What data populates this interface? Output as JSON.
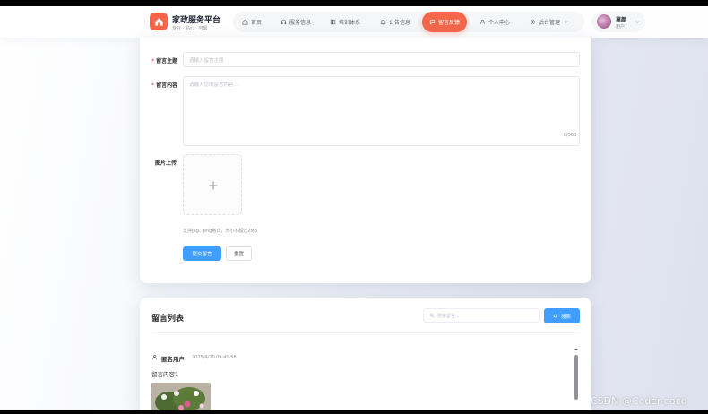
{
  "header": {
    "site_title": "家政服务平台",
    "site_subtitle": "专业 · 贴心 · 可靠",
    "nav": [
      {
        "label": "首页",
        "icon": "home-icon"
      },
      {
        "label": "服务信息",
        "icon": "headset-icon"
      },
      {
        "label": "培训体系",
        "icon": "book-icon"
      },
      {
        "label": "公告信息",
        "icon": "bell-icon"
      },
      {
        "label": "留言反馈",
        "icon": "chat-icon",
        "active": true
      },
      {
        "label": "个人中心",
        "icon": "user-icon"
      },
      {
        "label": "后台管理",
        "icon": "gear-icon"
      }
    ],
    "user": {
      "name": "莫颜",
      "role": "用户"
    }
  },
  "form": {
    "subject_label": "留言主题",
    "subject_placeholder": "请输入留言主题",
    "content_label": "留言内容",
    "content_placeholder": "请输入您的留言内容...",
    "content_counter": "0/500",
    "upload_label": "图片上传",
    "upload_hint": "支持jpg、png格式，大小不超过2MB",
    "submit_label": "提交留言",
    "reset_label": "重置"
  },
  "list": {
    "title": "留言列表",
    "search_placeholder": "搜索留言...",
    "search_button": "搜索",
    "messages": [
      {
        "author": "匿名用户",
        "time": "2025/4/20 09:40:58",
        "content": "留言内容1"
      }
    ]
  },
  "colors": {
    "accent": "#f4664a",
    "primary": "#409eff"
  },
  "watermark": "CSDN @Coder-coco"
}
